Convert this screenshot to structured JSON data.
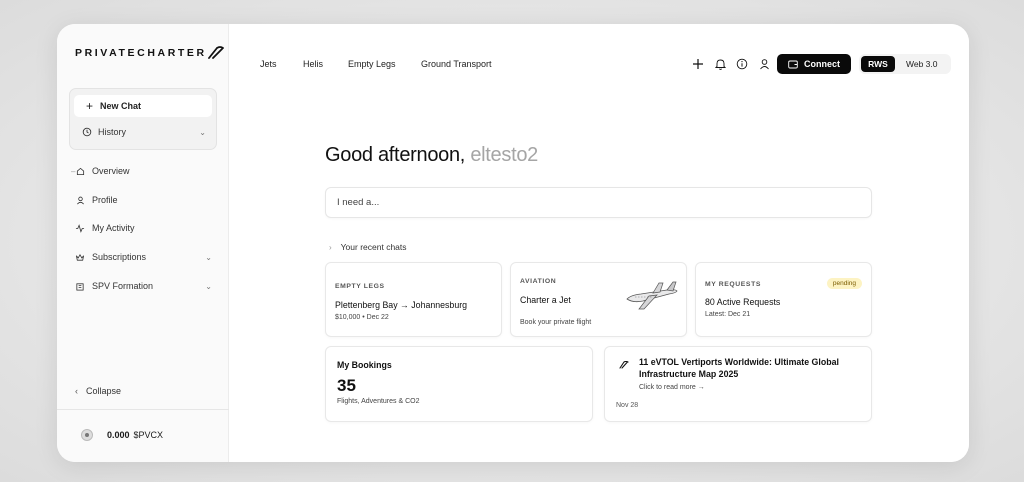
{
  "brand": {
    "name": "PRIVATECHARTER"
  },
  "sidebar": {
    "new_chat": "New Chat",
    "history": "History",
    "items": [
      {
        "label": "Overview",
        "icon": "home-icon"
      },
      {
        "label": "Profile",
        "icon": "user-icon"
      },
      {
        "label": "My Activity",
        "icon": "activity-icon"
      },
      {
        "label": "Subscriptions",
        "icon": "crown-icon"
      },
      {
        "label": "SPV Formation",
        "icon": "building-icon"
      }
    ],
    "collapse": "Collapse",
    "wallet": {
      "amount": "0.000",
      "currency": "$PVCX"
    }
  },
  "topnav": {
    "links": [
      "Jets",
      "Helis",
      "Empty Legs",
      "Ground Transport"
    ]
  },
  "header": {
    "connect": "Connect",
    "toggle": {
      "active": "RWS",
      "inactive": "Web 3.0"
    }
  },
  "greeting": {
    "text": "Good afternoon,",
    "user": "eltesto2"
  },
  "search": {
    "placeholder": "I need a..."
  },
  "recent_label": "Your recent chats",
  "cards": {
    "empty_legs": {
      "kicker": "EMPTY LEGS",
      "route": "Plettenberg Bay → Johannesburg",
      "meta": "$10,000 • Dec 22"
    },
    "aviation": {
      "kicker": "AVIATION",
      "title": "Charter a Jet",
      "sub": "Book your private flight"
    },
    "requests": {
      "kicker": "MY REQUESTS",
      "badge": "pending",
      "title": "80 Active Requests",
      "sub": "Latest: Dec 21"
    },
    "bookings": {
      "title": "My Bookings",
      "count": "35",
      "sub": "Flights, Adventures & CO2"
    },
    "news": {
      "title_line1": "11 eVTOL Vertiports Worldwide: Ultimate Global",
      "title_line2": "Infrastructure Map 2025",
      "cta": "Click to read more →",
      "date": "Nov 28"
    }
  },
  "colors": {
    "accent": "#0a0a0a",
    "badge_bg": "#fdf3c3",
    "muted_user": "#a5a5a5"
  }
}
